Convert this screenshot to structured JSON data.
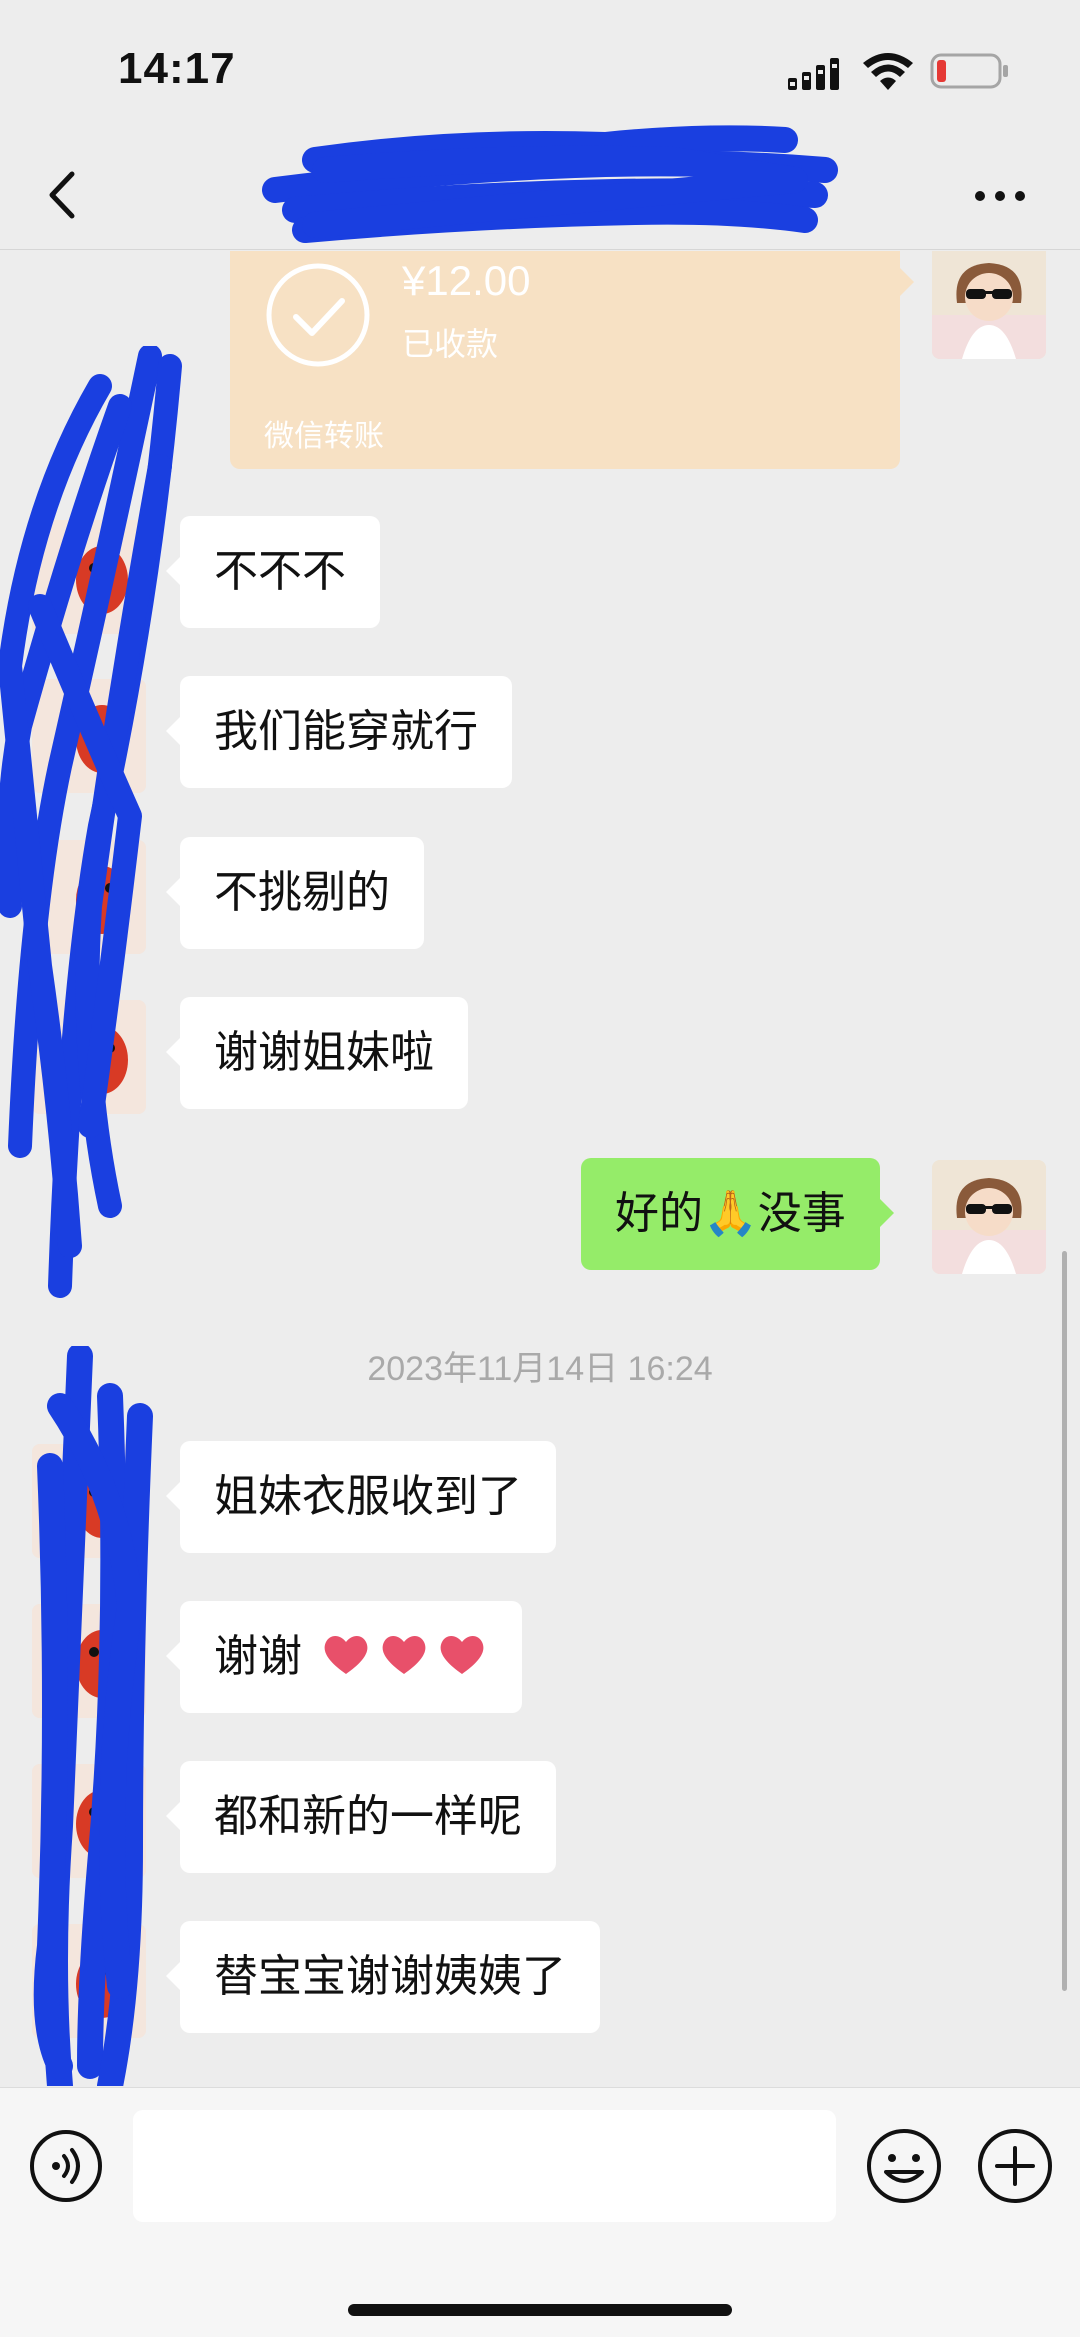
{
  "status_bar": {
    "time": "14:17"
  },
  "nav": {
    "title": ""
  },
  "transfer": {
    "amount": "¥12.00",
    "status": "已收款",
    "footer": "微信转账"
  },
  "messages_before": [
    {
      "side": "left",
      "text": "不不不"
    },
    {
      "side": "left",
      "text": "我们能穿就行"
    },
    {
      "side": "left",
      "text": "不挑剔的"
    },
    {
      "side": "left",
      "text": "谢谢姐妹啦"
    },
    {
      "side": "right",
      "text": "好的",
      "emoji": "🙏",
      "text_after": "没事"
    }
  ],
  "timestamp": "2023年11月14日 16:24",
  "messages_after": [
    {
      "side": "left",
      "text": "姐妹衣服收到了"
    },
    {
      "side": "left",
      "text": "谢谢",
      "emoji_count": 3
    },
    {
      "side": "left",
      "text": "都和新的一样呢"
    },
    {
      "side": "left",
      "text": "替宝宝谢谢姨姨了"
    }
  ],
  "input": {
    "value": "",
    "placeholder": ""
  },
  "colors": {
    "background": "#ededed",
    "bubble_self": "#95ec69",
    "bubble_other": "#ffffff",
    "transfer_card": "#f7e1c4",
    "redaction": "#1a3fe0",
    "battery_low": "#e53935"
  },
  "icons": {
    "back": "chevron-left-icon",
    "more": "more-dots-icon",
    "voice": "voice-icon",
    "emoji": "emoji-icon",
    "plus": "plus-icon",
    "transfer": "check-circle-icon",
    "heart": "heart-icon"
  }
}
